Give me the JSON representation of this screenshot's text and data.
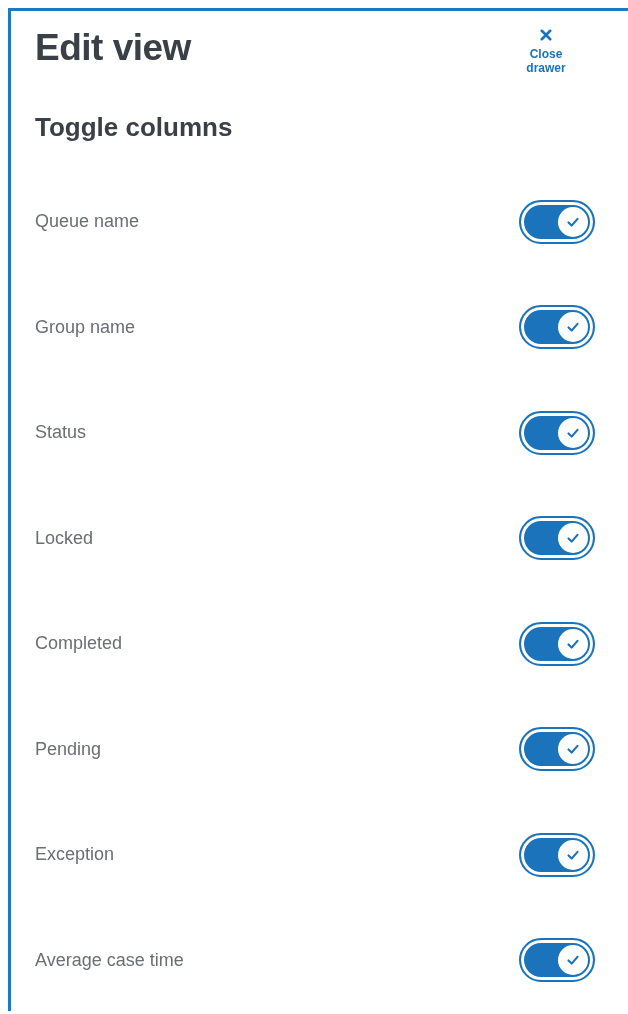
{
  "drawer": {
    "title": "Edit view",
    "close_label": "Close drawer"
  },
  "section": {
    "heading": "Toggle columns"
  },
  "columns": [
    {
      "label": "Queue name",
      "on": true
    },
    {
      "label": "Group name",
      "on": true
    },
    {
      "label": "Status",
      "on": true
    },
    {
      "label": "Locked",
      "on": true
    },
    {
      "label": "Completed",
      "on": true
    },
    {
      "label": "Pending",
      "on": true
    },
    {
      "label": "Exception",
      "on": true
    },
    {
      "label": "Average case time",
      "on": true
    }
  ]
}
